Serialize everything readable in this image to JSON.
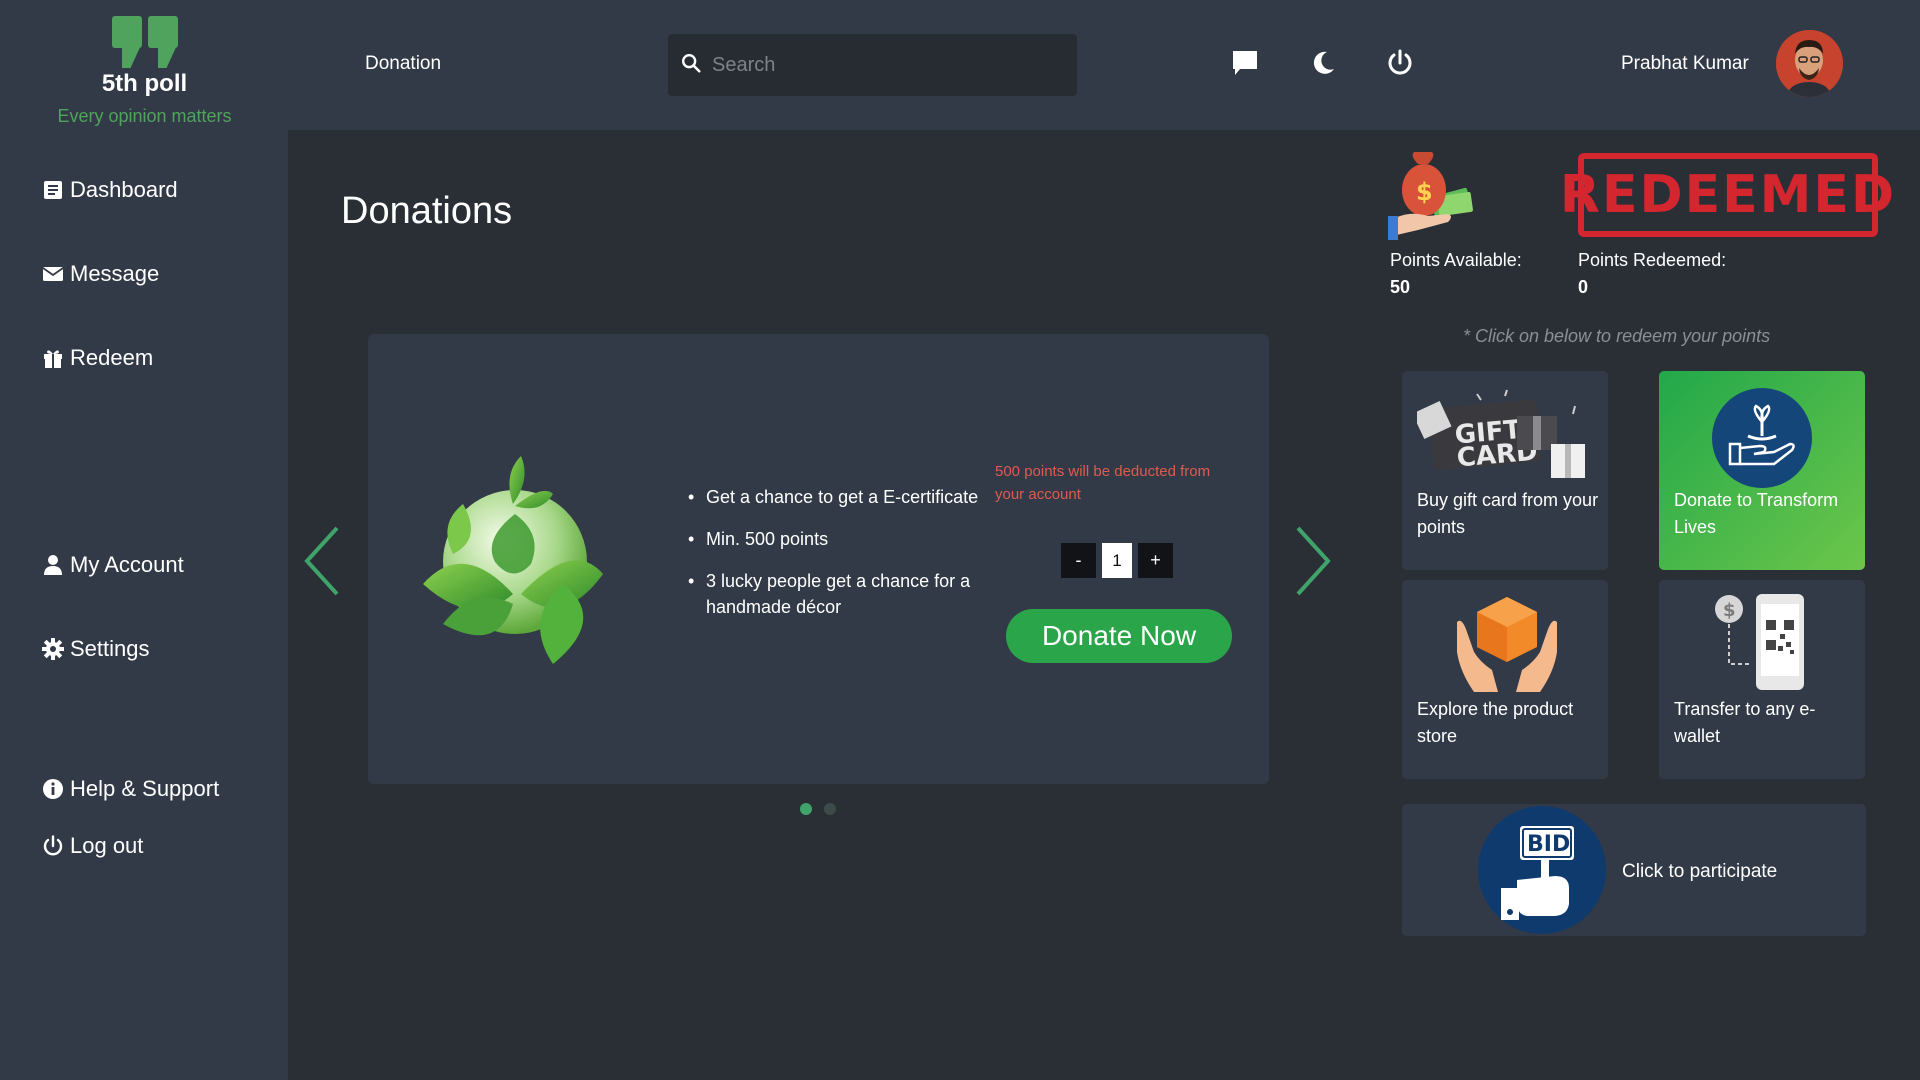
{
  "brand": {
    "name": "5th poll",
    "tagline": "Every opinion matters",
    "accent": "#4fa35c"
  },
  "header": {
    "page_label": "Donation",
    "search_placeholder": "Search",
    "icons": [
      "chat-icon",
      "moon-icon",
      "power-icon"
    ],
    "user_name": "Prabhat Kumar"
  },
  "sidebar": {
    "items": [
      {
        "label": "Dashboard",
        "icon": "list-icon"
      },
      {
        "label": "Message",
        "icon": "envelope-icon"
      },
      {
        "label": "Redeem",
        "icon": "gift-icon"
      },
      {
        "label": "My Account",
        "icon": "user-icon"
      },
      {
        "label": "Settings",
        "icon": "gear-icon"
      },
      {
        "label": "Help & Support",
        "icon": "info-icon"
      },
      {
        "label": "Log out",
        "icon": "power-icon"
      }
    ]
  },
  "main": {
    "title": "Donations",
    "slide": {
      "bullets": [
        "Get a chance to get a E-certificate",
        "Min. 500 points",
        "3 lucky people get a chance for a handmade décor"
      ],
      "deduct_note": "500 points will be deducted from your account",
      "quantity": "1",
      "minus_label": "-",
      "plus_label": "+",
      "cta_label": "Donate Now"
    },
    "carousel_total": 2,
    "carousel_active": 1
  },
  "points": {
    "available_label": "Points Available:",
    "available_value": "50",
    "redeemed_label": "Points Redeemed:",
    "redeemed_value": "0",
    "stamp_text": "REDEEMED",
    "hint": "* Click on below to redeem your points"
  },
  "options": [
    {
      "label": "Buy gift card from your points",
      "icon": "gift-card-icon"
    },
    {
      "label": "Donate to Transform Lives",
      "icon": "donate-hand-icon",
      "highlight": true
    },
    {
      "label": "Explore the product store",
      "icon": "box-hands-icon"
    },
    {
      "label": "Transfer to any e-wallet",
      "icon": "phone-qr-icon"
    }
  ],
  "bid": {
    "label": "Click to participate",
    "icon_text": "BID"
  },
  "colors": {
    "background": "#2a2f36",
    "panel": "#333a47",
    "cta_green": "#2aa54a",
    "stamp_red": "#d3262f",
    "note_red": "#e05a4e"
  }
}
